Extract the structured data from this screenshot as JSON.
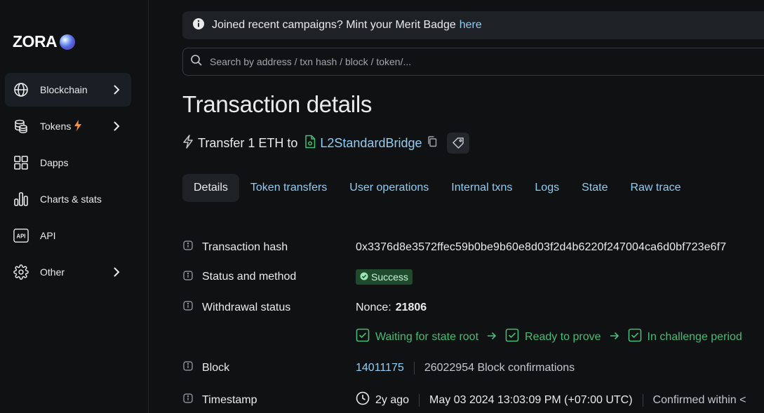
{
  "sidebar": {
    "logo_text": "ZORA",
    "items": [
      {
        "label": "Blockchain",
        "icon": "globe-icon",
        "chevron": true,
        "active": true
      },
      {
        "label": "Tokens",
        "icon": "coins-icon",
        "chevron": true,
        "badge_icon": "lightning-icon"
      },
      {
        "label": "Dapps",
        "icon": "apps-grid-icon",
        "chevron": false
      },
      {
        "label": "Charts & stats",
        "icon": "bar-chart-icon",
        "chevron": false
      },
      {
        "label": "API",
        "icon": "api-icon",
        "chevron": false
      },
      {
        "label": "Other",
        "icon": "gear-icon",
        "chevron": true
      }
    ]
  },
  "alert": {
    "text": "Joined recent campaigns? Mint your Merit Badge",
    "link_text": "here"
  },
  "search": {
    "placeholder": "Search by address / txn hash / block / token/..."
  },
  "page": {
    "title": "Transaction details",
    "subheader_prefix": "Transfer 1 ETH to",
    "contract_name": "L2StandardBridge"
  },
  "tabs": [
    {
      "label": "Details",
      "active": true
    },
    {
      "label": "Token transfers"
    },
    {
      "label": "User operations"
    },
    {
      "label": "Internal txns"
    },
    {
      "label": "Logs"
    },
    {
      "label": "State"
    },
    {
      "label": "Raw trace"
    }
  ],
  "details": {
    "tx_hash": {
      "label": "Transaction hash",
      "value": "0x3376d8e3572ffec59b0be9b60e8d03f2d4b6220f247004ca6d0bf723e6f7"
    },
    "status": {
      "label": "Status and method",
      "value": "Success"
    },
    "withdrawal": {
      "label": "Withdrawal status",
      "nonce_label": "Nonce:",
      "nonce_value": "21806",
      "steps": [
        "Waiting for state root",
        "Ready to prove",
        "In challenge period"
      ]
    },
    "block": {
      "label": "Block",
      "number": "14011175",
      "confirmations": "26022954 Block confirmations"
    },
    "timestamp": {
      "label": "Timestamp",
      "relative": "2y ago",
      "absolute": "May 03 2024 13:03:09 PM (+07:00 UTC)",
      "confirmed": "Confirmed within <"
    }
  },
  "colors": {
    "background": "#101112",
    "link": "#90cdf4",
    "success": "#48bb78",
    "panel": "#1e2125"
  }
}
